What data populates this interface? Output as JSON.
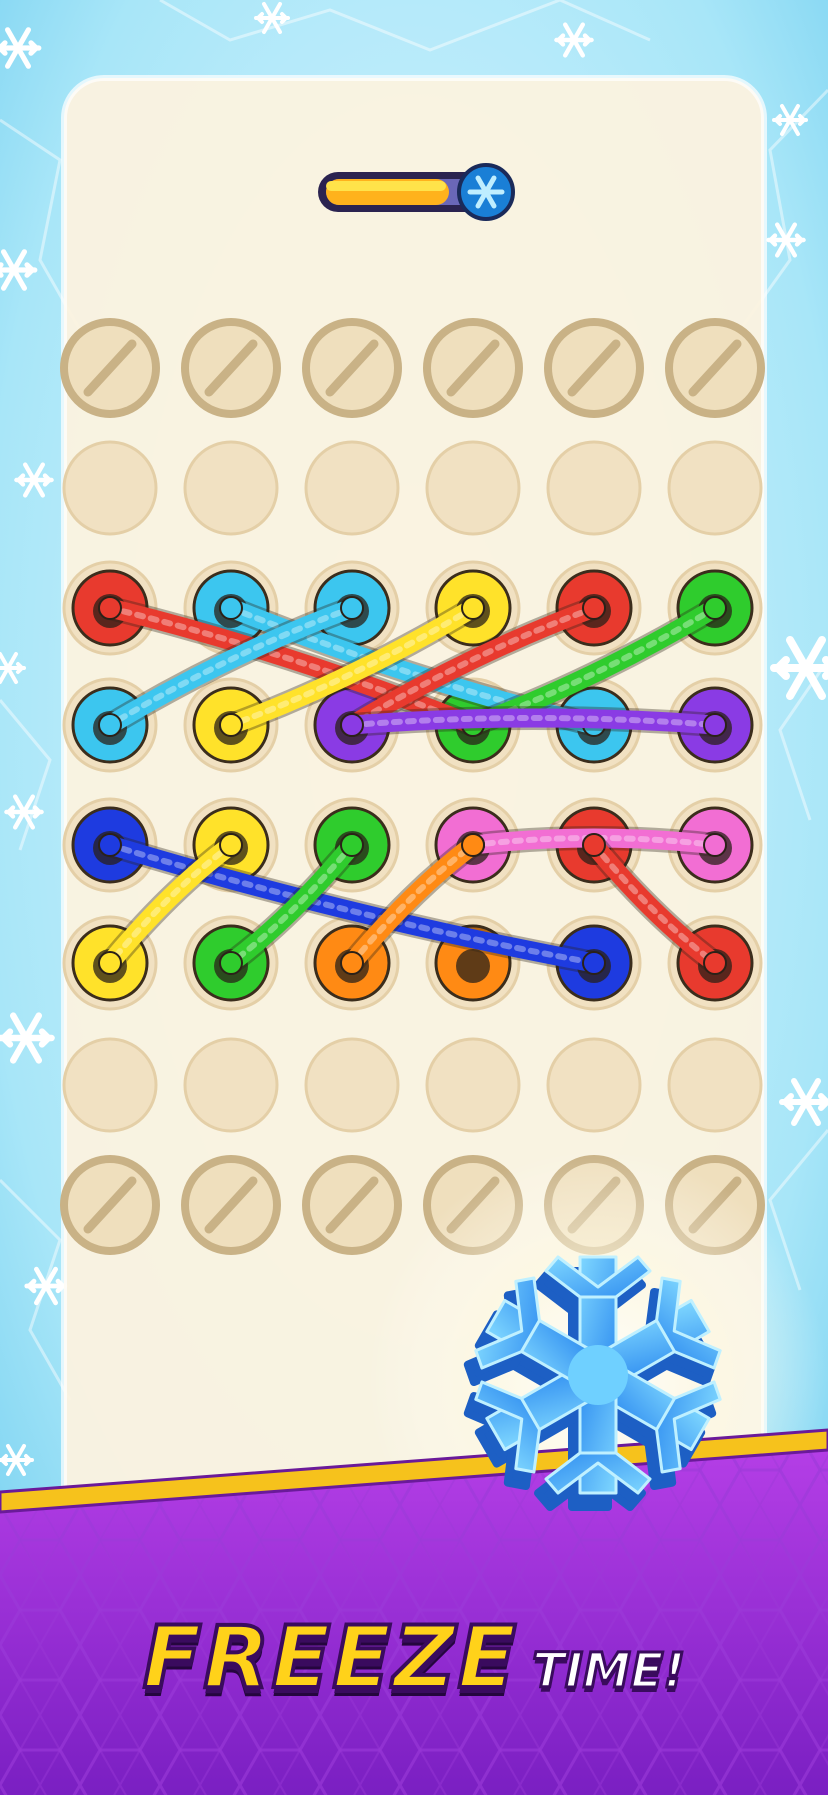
{
  "caption": {
    "highlight": "FREEZE",
    "rest": "TIME!"
  },
  "timer": {
    "level": 0.75
  },
  "colors": {
    "red": "#e83a2e",
    "cyan": "#3cc6ef",
    "yellow": "#ffe22a",
    "purple": "#8a3be4",
    "green": "#2fcc2d",
    "blue": "#1e3be0",
    "pink": "#f26ed3",
    "orange": "#ff8a14"
  },
  "board": {
    "rows": [
      [
        "blocked",
        "blocked",
        "blocked",
        "blocked",
        "blocked",
        "blocked"
      ],
      [
        "empty",
        "empty",
        "empty",
        "empty",
        "empty",
        "empty"
      ],
      [
        "red",
        "cyan",
        "cyan",
        "yellow",
        "red",
        "green"
      ],
      [
        "cyan",
        "yellow",
        "purple",
        "green",
        "cyan",
        "purple"
      ],
      [
        "blue",
        "yellow",
        "green",
        "pink",
        "red",
        "pink"
      ],
      [
        "yellow",
        "green",
        "orange",
        "orange",
        "blue",
        "red"
      ],
      [
        "empty",
        "empty",
        "empty",
        "empty",
        "empty",
        "empty"
      ],
      [
        "blocked",
        "blocked",
        "blocked",
        "blocked",
        "blocked",
        "blocked"
      ]
    ]
  },
  "ropes": [
    {
      "color": "red",
      "from": [
        2,
        0
      ],
      "to": [
        3,
        3
      ]
    },
    {
      "color": "cyan",
      "from": [
        2,
        1
      ],
      "to": [
        3,
        4
      ]
    },
    {
      "color": "cyan",
      "from": [
        2,
        2
      ],
      "to": [
        3,
        0
      ]
    },
    {
      "color": "yellow",
      "from": [
        2,
        3
      ],
      "to": [
        3,
        1
      ]
    },
    {
      "color": "red",
      "from": [
        2,
        4
      ],
      "to": [
        3,
        2
      ]
    },
    {
      "color": "green",
      "from": [
        2,
        5
      ],
      "to": [
        3,
        3
      ]
    },
    {
      "color": "purple",
      "from": [
        3,
        2
      ],
      "to": [
        3,
        5
      ]
    },
    {
      "color": "blue",
      "from": [
        4,
        0
      ],
      "to": [
        5,
        4
      ]
    },
    {
      "color": "yellow",
      "from": [
        4,
        1
      ],
      "to": [
        5,
        0
      ]
    },
    {
      "color": "green",
      "from": [
        4,
        2
      ],
      "to": [
        5,
        1
      ]
    },
    {
      "color": "pink",
      "from": [
        4,
        3
      ],
      "to": [
        4,
        5
      ]
    },
    {
      "color": "red",
      "from": [
        4,
        4
      ],
      "to": [
        5,
        5
      ]
    },
    {
      "color": "orange",
      "from": [
        5,
        2
      ],
      "to": [
        4,
        3
      ]
    }
  ]
}
